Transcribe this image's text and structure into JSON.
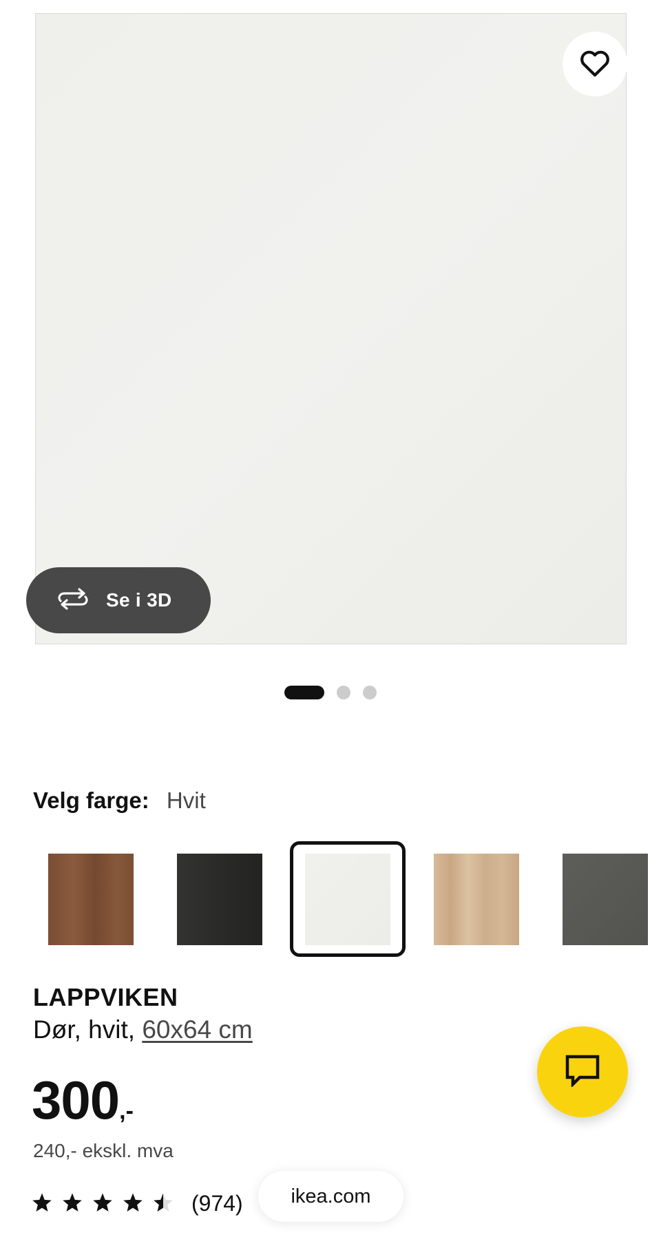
{
  "hero": {
    "favorite_icon": "heart-icon",
    "view_3d_icon": "rotate-3d-icon",
    "view_3d_label": "Se i 3D"
  },
  "carousel": {
    "total": 3,
    "active_index": 0
  },
  "color_picker": {
    "label": "Velg farge:",
    "selected_value": "Hvit",
    "swatches": [
      {
        "name": "brown-walnut",
        "color": "#7e5237"
      },
      {
        "name": "black",
        "color": "#2b2b29"
      },
      {
        "name": "white",
        "color": "#eeeeeb",
        "selected": true
      },
      {
        "name": "light-oak",
        "color": "#cfb08f"
      },
      {
        "name": "dark-grey",
        "color": "#575754"
      }
    ]
  },
  "product": {
    "name": "LAPPVIKEN",
    "description_prefix": "Dør, hvit, ",
    "size_link": "60x64 cm",
    "price_integer": "300",
    "price_suffix": ",-",
    "price_ex_vat": "240,- ekskl. mva",
    "rating_value": 4.5,
    "rating_max": 5,
    "review_count": "(974)"
  },
  "chat": {
    "icon": "chat-bubble-icon"
  },
  "browser": {
    "url": "ikea.com"
  },
  "colors": {
    "brand_yellow": "#fad30f",
    "dark_button": "#484848"
  }
}
